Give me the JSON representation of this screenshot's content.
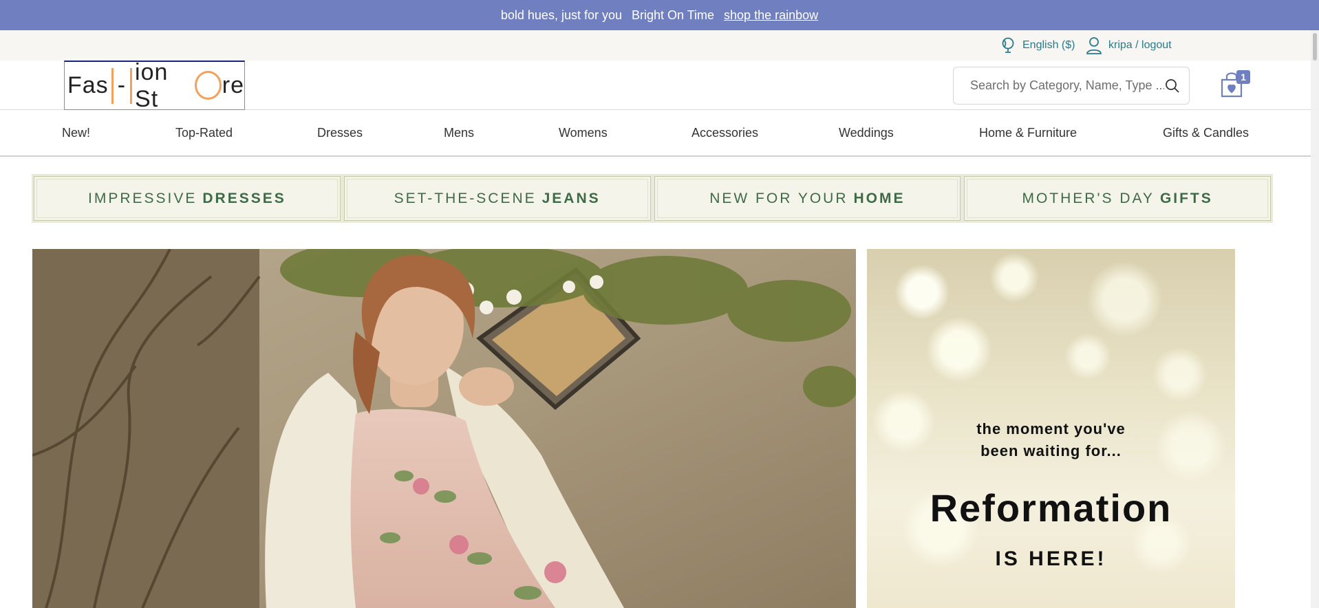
{
  "announcement": {
    "text1": "bold hues, just for you",
    "text2": "Bright On Time",
    "link": "shop the rainbow"
  },
  "utility": {
    "language": "English ($)",
    "account": "kripa / logout"
  },
  "header": {
    "logo_text": "Fashion Store",
    "logo_left": "Fas",
    "logo_mid": "-",
    "logo_ion": "ion St",
    "logo_end": "re",
    "search_placeholder": "Search by Category, Name, Type ...",
    "cart_count": "1"
  },
  "nav": {
    "items": [
      {
        "label": "New!"
      },
      {
        "label": "Top-Rated"
      },
      {
        "label": "Dresses"
      },
      {
        "label": "Mens"
      },
      {
        "label": "Womens"
      },
      {
        "label": "Accessories"
      },
      {
        "label": "Weddings"
      },
      {
        "label": "Home & Furniture"
      },
      {
        "label": "Gifts & Candles"
      }
    ]
  },
  "promos": [
    {
      "light": "IMPRESSIVE",
      "bold": "DRESSES"
    },
    {
      "light": "SET-THE-SCENE",
      "bold": "JEANS"
    },
    {
      "light": "NEW FOR YOUR",
      "bold": "HOME"
    },
    {
      "light": "MOTHER'S DAY",
      "bold": "GIFTS"
    }
  ],
  "hero_side": {
    "line1": "the moment you've",
    "line2": "been waiting for...",
    "brand": "Reformation",
    "tagline": "IS HERE!"
  },
  "colors": {
    "announce_bg": "#6f7fc0",
    "utility_bg": "#f7f6f2",
    "link_teal": "#2a7a8c",
    "promo_text": "#3e6b47",
    "logo_accent": "#f4a05a"
  }
}
